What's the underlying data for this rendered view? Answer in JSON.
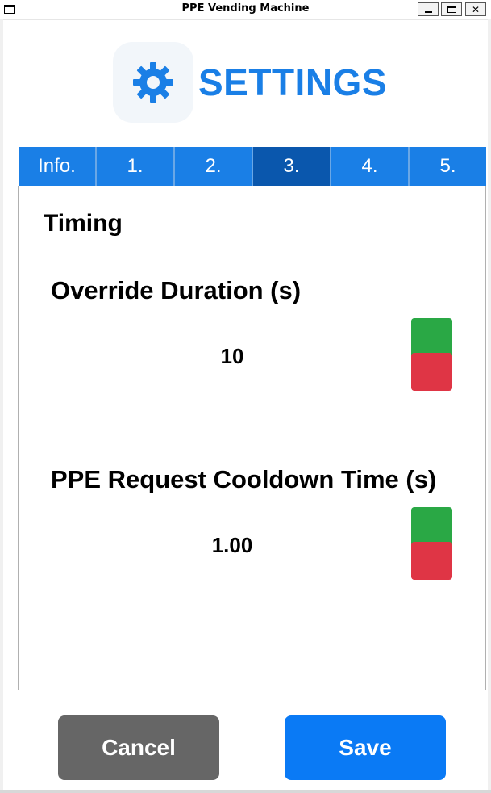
{
  "window": {
    "title": "PPE Vending Machine",
    "minimize": "",
    "maximize": "",
    "close": "✕"
  },
  "header": {
    "icon": "gear-icon",
    "title": "SETTINGS",
    "accent_color": "#1a7fe6"
  },
  "tabs": [
    {
      "label": "Info.",
      "active": false
    },
    {
      "label": "1.",
      "active": false
    },
    {
      "label": "2.",
      "active": false
    },
    {
      "label": "3.",
      "active": true
    },
    {
      "label": "4.",
      "active": false
    },
    {
      "label": "5.",
      "active": false
    }
  ],
  "section": {
    "title": "Timing",
    "settings": [
      {
        "label": "Override Duration (s)",
        "value": "10"
      },
      {
        "label": "PPE Request Cooldown Time (s)",
        "value": "1.00"
      }
    ]
  },
  "stepper_colors": {
    "increase": "#2aa845",
    "decrease": "#df3545"
  },
  "footer": {
    "cancel_label": "Cancel",
    "save_label": "Save"
  }
}
